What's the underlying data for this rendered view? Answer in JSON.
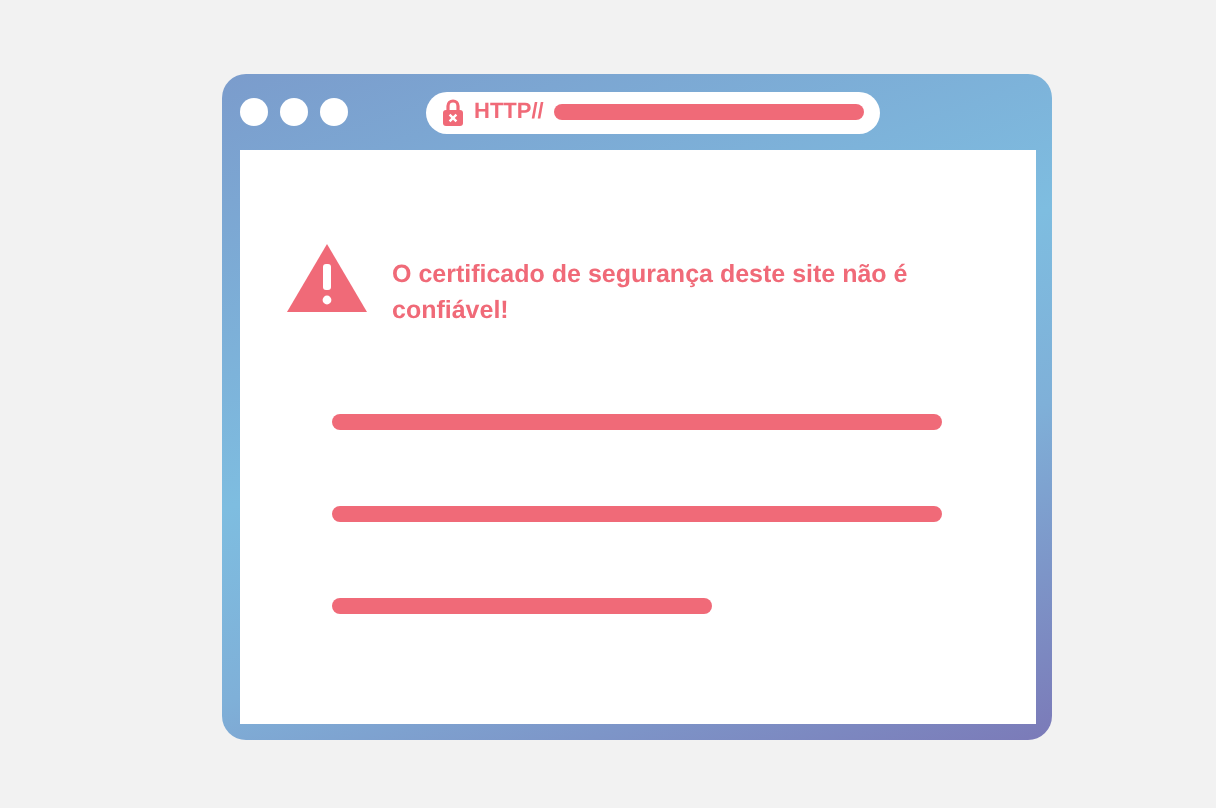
{
  "window": {
    "address_bar": {
      "protocol": "HTTP//"
    }
  },
  "warning": {
    "message": "O certificado de segurança deste site não é confiável!"
  }
}
